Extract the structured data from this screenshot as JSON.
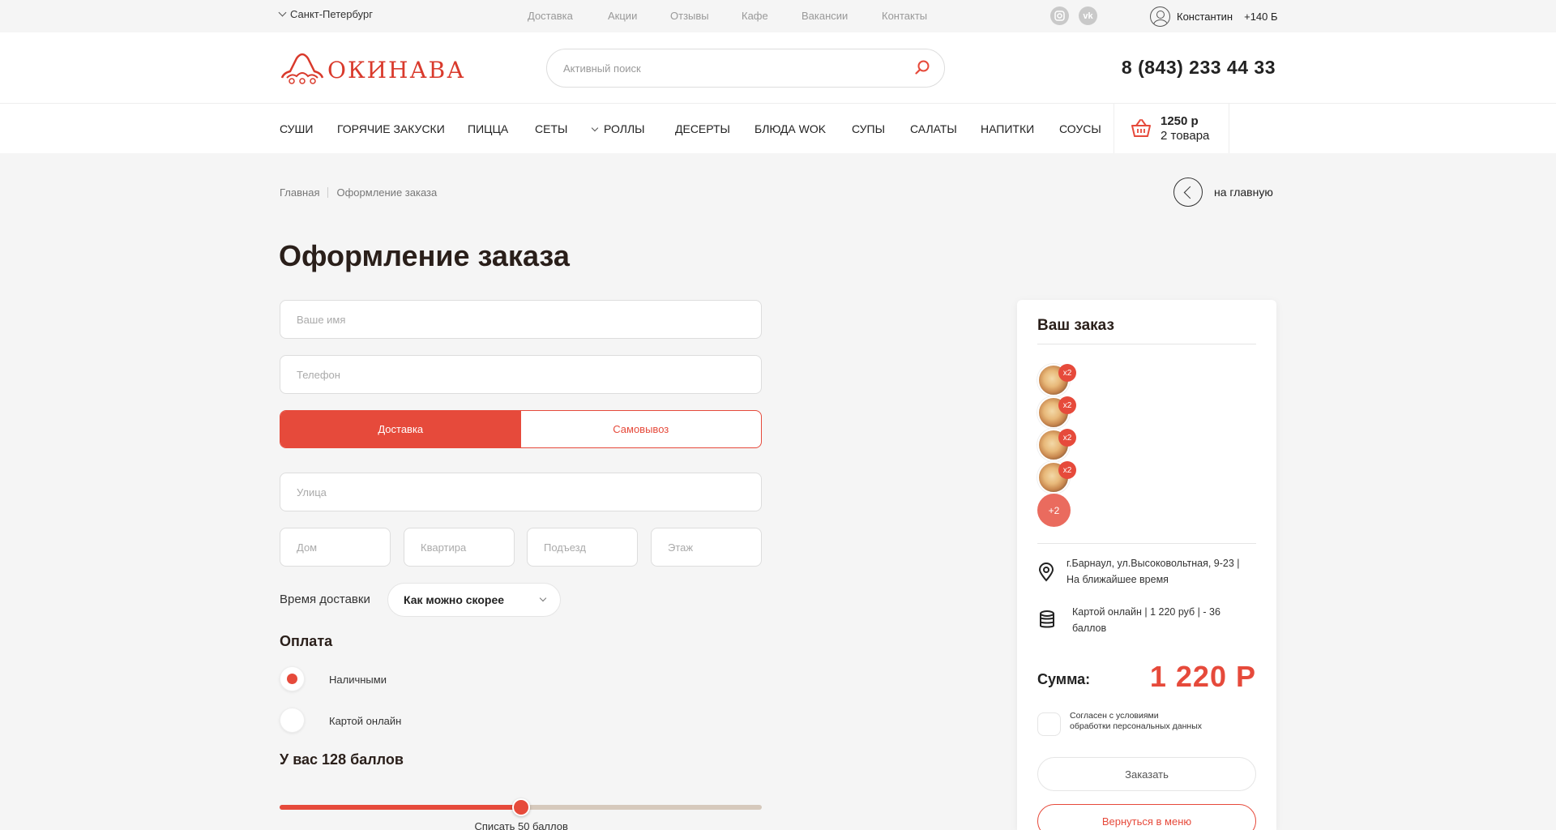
{
  "topbar": {
    "city": "Санкт-Петербург",
    "nav": [
      "Доставка",
      "Акции",
      "Отзывы",
      "Кафе",
      "Вакансии",
      "Контакты"
    ],
    "social": [
      {
        "icon": "instagram-icon"
      },
      {
        "icon": "vk-icon"
      }
    ],
    "user_name": "Константин",
    "user_points": "+140 Б"
  },
  "header": {
    "logo_text": "ОКИНАВА",
    "search_placeholder": "Активный поиск",
    "phone": "8 (843) 233 44 33"
  },
  "categories": [
    "СУШИ",
    "ГОРЯЧИЕ ЗАКУСКИ",
    "ПИЦЦА",
    "СЕТЫ",
    "РОЛЛЫ",
    "ДЕСЕРТЫ",
    "БЛЮДА WOK",
    "СУПЫ",
    "САЛАТЫ",
    "НАПИТКИ",
    "СОУСЫ"
  ],
  "cart": {
    "sum": "1250 р",
    "count": "2 товара"
  },
  "breadcrumb": {
    "home": "Главная",
    "current": "Оформление заказа"
  },
  "back_label": "на главную",
  "page_title": "Оформление заказа",
  "form": {
    "name_placeholder": "Ваше имя",
    "phone_placeholder": "Телефон",
    "delivery_label": "Доставка",
    "pickup_label": "Самовывоз",
    "street_placeholder": "Улица",
    "house_placeholder": "Дом",
    "apt_placeholder": "Квартира",
    "entrance_placeholder": "Подъезд",
    "floor_placeholder": "Этаж",
    "time_label": "Время доставки",
    "time_value": "Как можно скорее",
    "payment_title": "Оплата",
    "pay_cash": "Наличными",
    "pay_card": "Картой онлайн",
    "points_title": "У вас 128 баллов",
    "slider_caption": "Списать 50 баллов",
    "slider_fraction": 0.5
  },
  "order": {
    "title": "Ваш заказ",
    "items": [
      {
        "qty": "x2"
      },
      {
        "qty": "x2"
      },
      {
        "qty": "x2"
      },
      {
        "qty": "x2"
      }
    ],
    "more": "+2",
    "address_line1": "г.Барнаул, ул.Высоковольтная, 9-23 |",
    "address_line2": "На ближайшее время",
    "payment_line1": "Картой онлайн | 1 220 руб | - 36",
    "payment_line2": "баллов",
    "sum_label": "Сумма:",
    "sum_value": "1 220 Р",
    "consent_line1": "Согласен с условиями",
    "consent_line2": "обработки персональных данных",
    "order_button": "Заказать",
    "menu_button": "Вернуться в меню"
  },
  "colors": {
    "accent": "#e64a3b",
    "slider_track": "#d6c9bc",
    "background": "#f5f5f5"
  }
}
